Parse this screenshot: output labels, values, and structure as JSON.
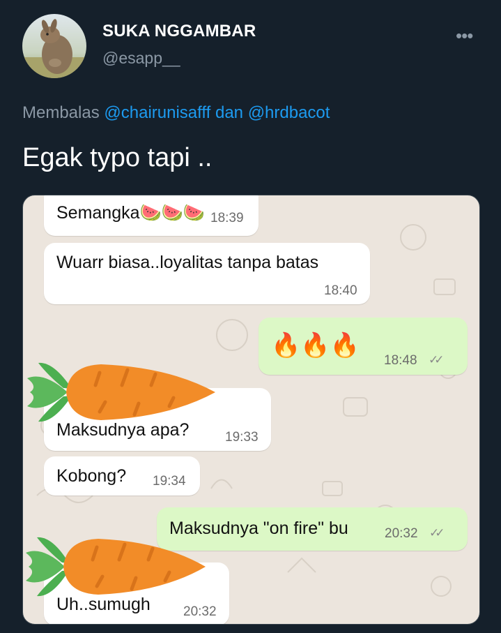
{
  "tweet": {
    "display_name": "SUKA NGGAMBAR",
    "handle": "@esapp__",
    "more_icon": "ellipsis-icon",
    "reply_prefix": "Membalas",
    "reply_user_1": "@chairunisafff",
    "reply_conj": "dan",
    "reply_user_2": "@hrdbacot",
    "text": "Egak typo tapi .."
  },
  "colors": {
    "background": "#15202b",
    "link": "#1d9bf0",
    "muted": "#8b98a5",
    "chat_background": "#ece5dd",
    "bubble_in": "#ffffff",
    "bubble_out": "#dcf8c6"
  },
  "chat": {
    "messages": [
      {
        "dir": "in",
        "text": "Semangka🍉🍉🍉",
        "time": "18:39"
      },
      {
        "dir": "in",
        "text": "Wuarr biasa..loyalitas tanpa batas",
        "time": "18:40"
      },
      {
        "dir": "out",
        "text": "🔥🔥🔥",
        "time": "18:48",
        "status": "read-ticks-icon"
      },
      {
        "dir": "in",
        "text": "Maksudnya apa?",
        "time": "19:33"
      },
      {
        "dir": "in",
        "text": "Kobong?",
        "time": "19:34"
      },
      {
        "dir": "out",
        "text": "Maksudnya \"on fire\" bu",
        "time": "20:32",
        "status": "read-ticks-icon"
      },
      {
        "dir": "in",
        "text": "Uh..sumugh",
        "time": "20:32"
      }
    ],
    "overlays": [
      "carrot-sticker-icon",
      "carrot-sticker-icon"
    ]
  }
}
